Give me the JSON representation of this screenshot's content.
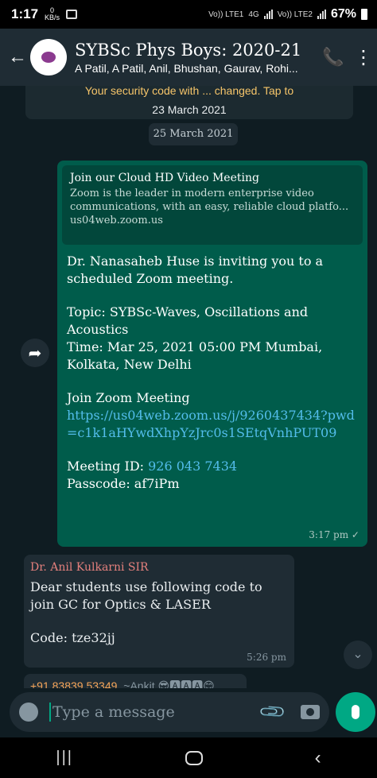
{
  "statusbar": {
    "time": "1:17",
    "net_speed": "0",
    "net_unit": "KB/s",
    "sim1": "Vo)) LTE1",
    "sim1_net": "4G",
    "sim2": "Vo)) LTE2",
    "battery": "67%"
  },
  "header": {
    "title": "SYBSc Phys Boys: 2020-21",
    "subtitle": "A Patil, A Patil, Anil, Bhushan, Gaurav, Rohi..."
  },
  "system_message": {
    "text": "Your security code with ... changed. Tap to",
    "date": "23 March 2021"
  },
  "date_chip": "25 March 2021",
  "outgoing": {
    "preview_title": "Join our Cloud HD Video Meeting",
    "preview_desc_1": "Zoom is the leader in modern enterprise video",
    "preview_desc_2": "communications, with an easy, reliable cloud platfo...",
    "preview_url": "us04web.zoom.us",
    "line_invite": "Dr. Nanasaheb Huse is inviting you to a scheduled Zoom meeting.",
    "line_topic": "Topic: SYBSc-Waves, Oscillations and Acoustics",
    "line_time": "Time: Mar 25, 2021 05:00 PM Mumbai, Kolkata, New Delhi",
    "line_join": "Join Zoom Meeting",
    "link": "https://us04web.zoom.us/j/9260437434?pwd=c1k1aHYwdXhpYzJrc0s1SEtqVnhPUT09",
    "meeting_id_label": "Meeting ID: ",
    "meeting_id": "926 043 7434",
    "passcode": "Passcode: af7iPm",
    "time": "3:17 pm ✓"
  },
  "incoming": {
    "sender": "Dr. Anil Kulkarni SIR",
    "line1": "Dear  students use following code to join GC for Optics & LASER",
    "line2": "Code: tze32jj",
    "time": "5:26 pm"
  },
  "partial_message": {
    "number": "+91 83839 53349",
    "name": "~Ankit 😎🅰🅰🅰😊"
  },
  "input": {
    "placeholder": "Type a message"
  }
}
